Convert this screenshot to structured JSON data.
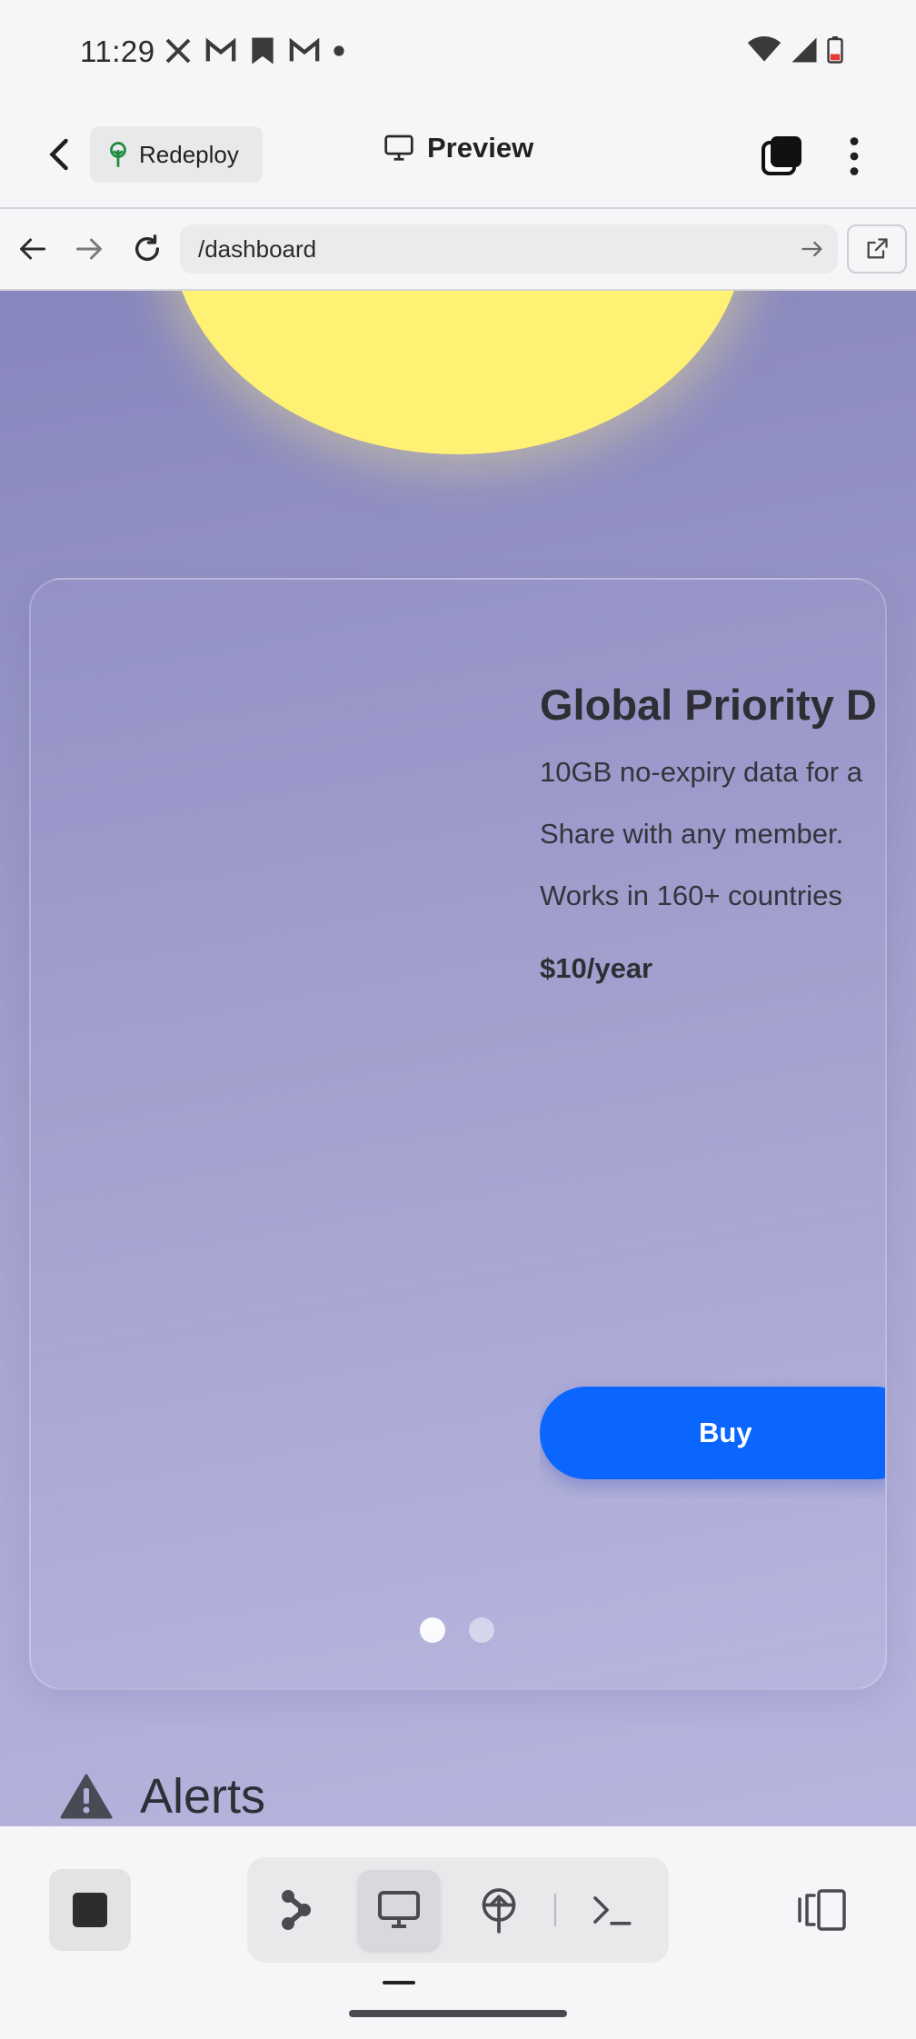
{
  "status_bar": {
    "time": "11:29",
    "notification_icons": [
      "x-icon",
      "gmail-icon",
      "bookmark-icon",
      "gmail-icon",
      "dot-icon"
    ],
    "system_icons": [
      "wifi-icon",
      "signal-icon",
      "battery-low-icon"
    ]
  },
  "app_bar": {
    "redeploy_label": "Redeploy",
    "title": "Preview"
  },
  "url_bar": {
    "url": "/dashboard"
  },
  "page": {
    "card": {
      "title": "Global Priority D",
      "lines": [
        "10GB no-expiry data for a",
        "Share with any member.",
        "Works in 160+ countries"
      ],
      "price": "$10/year",
      "buy_label": "Buy",
      "pages": 2,
      "active_page": 1
    },
    "alerts_heading": "Alerts"
  },
  "bottom_bar": {
    "segments": [
      "graph-icon",
      "monitor-icon",
      "deploy-icon",
      "terminal-icon"
    ],
    "active_segment": "monitor-icon"
  },
  "colors": {
    "accent": "#0a66ff",
    "sun": "#fff173",
    "background_start": "#8786bd",
    "background_end": "#b6b5de"
  }
}
